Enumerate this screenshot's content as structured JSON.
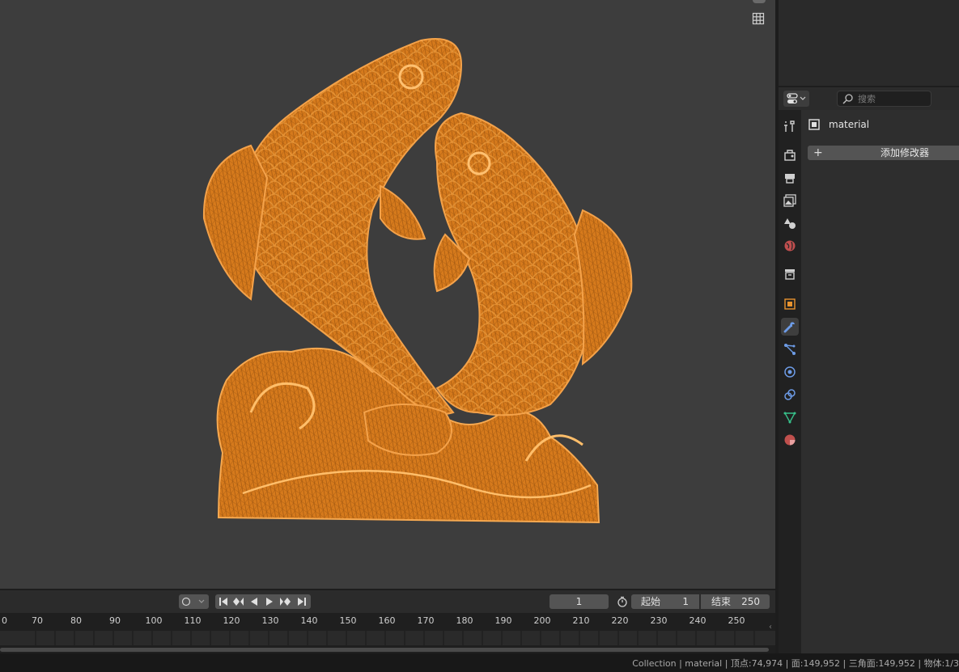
{
  "viewport": {
    "grid_icon": "grid-icon",
    "object_highlight_color": "#e8922a"
  },
  "timeline": {
    "keyframe_icon": "keyframe-dot-icon",
    "current_frame": "1",
    "start_label": "起始",
    "start_value": "1",
    "end_label": "结束",
    "end_value": "250",
    "ticks": [
      "0",
      "70",
      "80",
      "90",
      "100",
      "110",
      "120",
      "130",
      "140",
      "150",
      "160",
      "170",
      "180",
      "190",
      "200",
      "210",
      "220",
      "230",
      "240",
      "250"
    ]
  },
  "properties": {
    "search_placeholder": "搜索",
    "object_name": "material",
    "add_modifier_label": "添加修改器",
    "tabs": [
      {
        "name": "tool-tab",
        "icon": "tool-icon"
      },
      {
        "name": "render-tab",
        "icon": "render-icon"
      },
      {
        "name": "output-tab",
        "icon": "printer-icon"
      },
      {
        "name": "view-layer-tab",
        "icon": "image-icon"
      },
      {
        "name": "scene-tab",
        "icon": "scene-icon"
      },
      {
        "name": "world-tab",
        "icon": "world-icon"
      },
      {
        "name": "collection-tab",
        "icon": "collection-icon"
      },
      {
        "name": "object-tab",
        "icon": "object-icon"
      },
      {
        "name": "modifier-tab",
        "icon": "wrench-icon"
      },
      {
        "name": "particles-tab",
        "icon": "particles-icon"
      },
      {
        "name": "physics-tab",
        "icon": "physics-icon"
      },
      {
        "name": "constraints-tab",
        "icon": "constraint-icon"
      },
      {
        "name": "data-tab",
        "icon": "mesh-data-icon"
      },
      {
        "name": "material-tab",
        "icon": "material-icon"
      }
    ],
    "active_tab": "modifier-tab"
  },
  "statusbar": {
    "text": "Collection | material | 顶点:74,974 | 面:149,952 | 三角面:149,952 | 物体:1/3"
  }
}
